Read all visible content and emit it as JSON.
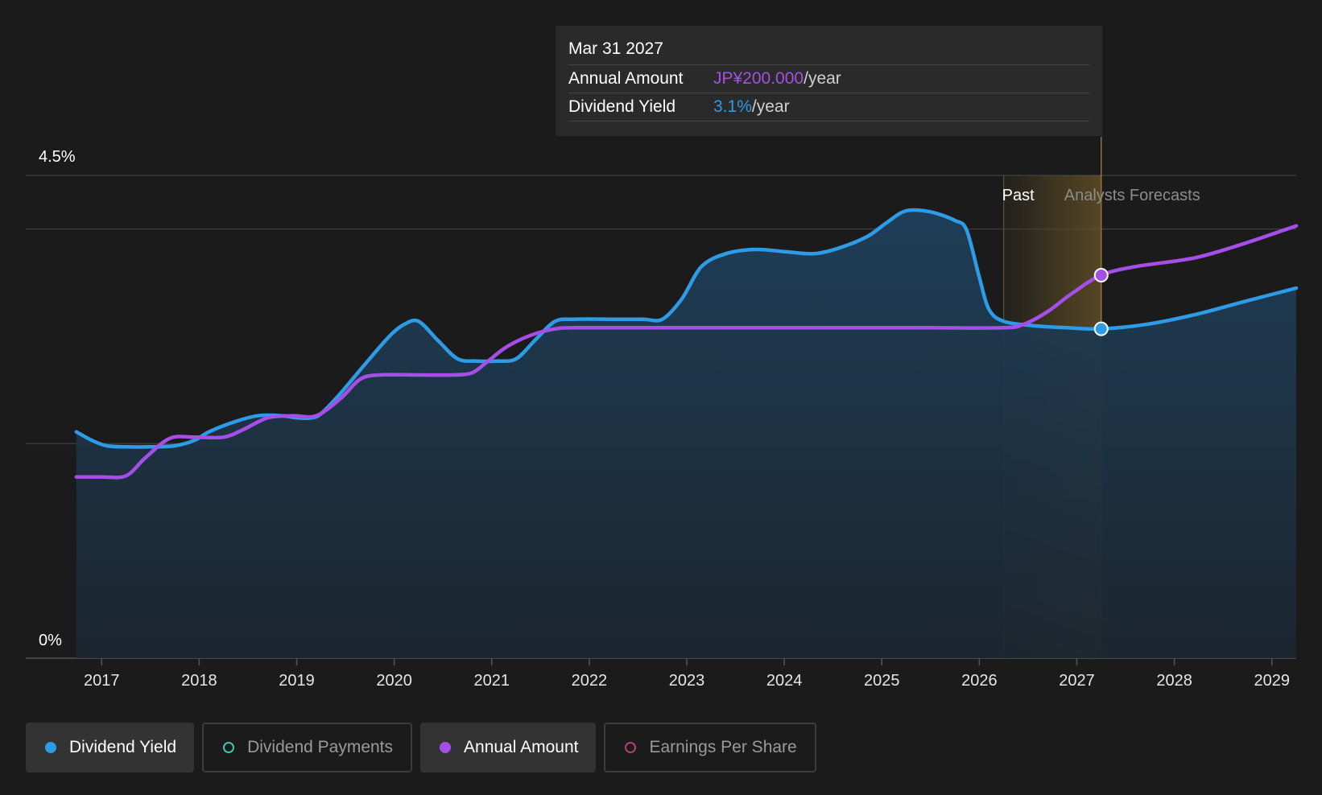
{
  "chart_data": {
    "type": "line",
    "y_ticks": [
      "4.5%",
      "0%"
    ],
    "ylim": [
      0,
      4.5
    ],
    "x_ticks": [
      "2017",
      "2018",
      "2019",
      "2020",
      "2021",
      "2022",
      "2023",
      "2024",
      "2025",
      "2026",
      "2027",
      "2028",
      "2029"
    ],
    "xlim": [
      2016.75,
      2029.25
    ],
    "zones": {
      "past_label": "Past",
      "forecast_label": "Analysts Forecasts",
      "past_end": 2026.25,
      "cursor": 2027.25
    },
    "series": [
      {
        "name": "Dividend Yield",
        "color": "#2d9be5",
        "fill": true,
        "points": [
          [
            2016.74,
            2.11
          ],
          [
            2016.9,
            2.03
          ],
          [
            2017.05,
            1.98
          ],
          [
            2017.25,
            1.97
          ],
          [
            2017.5,
            1.97
          ],
          [
            2017.75,
            1.98
          ],
          [
            2017.95,
            2.03
          ],
          [
            2018.1,
            2.11
          ],
          [
            2018.35,
            2.2
          ],
          [
            2018.6,
            2.26
          ],
          [
            2018.85,
            2.26
          ],
          [
            2019.0,
            2.24
          ],
          [
            2019.15,
            2.24
          ],
          [
            2019.25,
            2.28
          ],
          [
            2019.45,
            2.47
          ],
          [
            2019.7,
            2.74
          ],
          [
            2019.95,
            3.0
          ],
          [
            2020.1,
            3.11
          ],
          [
            2020.25,
            3.14
          ],
          [
            2020.45,
            2.96
          ],
          [
            2020.65,
            2.79
          ],
          [
            2020.85,
            2.77
          ],
          [
            2021.05,
            2.77
          ],
          [
            2021.25,
            2.79
          ],
          [
            2021.45,
            2.97
          ],
          [
            2021.65,
            3.14
          ],
          [
            2021.85,
            3.16
          ],
          [
            2022.25,
            3.16
          ],
          [
            2022.55,
            3.16
          ],
          [
            2022.75,
            3.16
          ],
          [
            2022.95,
            3.35
          ],
          [
            2023.15,
            3.65
          ],
          [
            2023.4,
            3.77
          ],
          [
            2023.7,
            3.81
          ],
          [
            2024.0,
            3.79
          ],
          [
            2024.3,
            3.77
          ],
          [
            2024.55,
            3.82
          ],
          [
            2024.85,
            3.93
          ],
          [
            2025.05,
            4.06
          ],
          [
            2025.25,
            4.17
          ],
          [
            2025.5,
            4.16
          ],
          [
            2025.75,
            4.08
          ],
          [
            2025.87,
            3.99
          ],
          [
            2026.0,
            3.55
          ],
          [
            2026.1,
            3.25
          ],
          [
            2026.25,
            3.14
          ],
          [
            2026.55,
            3.1
          ],
          [
            2026.9,
            3.08
          ],
          [
            2027.25,
            3.07
          ],
          [
            2027.7,
            3.11
          ],
          [
            2028.2,
            3.2
          ],
          [
            2028.7,
            3.32
          ],
          [
            2029.25,
            3.45
          ]
        ]
      },
      {
        "name": "Annual Amount",
        "color": "#a54ee8",
        "fill": false,
        "points": [
          [
            2016.74,
            1.69
          ],
          [
            2017.0,
            1.69
          ],
          [
            2017.25,
            1.7
          ],
          [
            2017.45,
            1.87
          ],
          [
            2017.7,
            2.05
          ],
          [
            2017.95,
            2.06
          ],
          [
            2018.25,
            2.06
          ],
          [
            2018.45,
            2.13
          ],
          [
            2018.7,
            2.24
          ],
          [
            2018.95,
            2.26
          ],
          [
            2019.2,
            2.26
          ],
          [
            2019.45,
            2.42
          ],
          [
            2019.65,
            2.6
          ],
          [
            2019.85,
            2.64
          ],
          [
            2020.25,
            2.64
          ],
          [
            2020.6,
            2.64
          ],
          [
            2020.8,
            2.66
          ],
          [
            2020.95,
            2.76
          ],
          [
            2021.15,
            2.9
          ],
          [
            2021.4,
            3.01
          ],
          [
            2021.65,
            3.07
          ],
          [
            2021.85,
            3.08
          ],
          [
            2022.5,
            3.08
          ],
          [
            2023.5,
            3.08
          ],
          [
            2024.5,
            3.08
          ],
          [
            2025.5,
            3.08
          ],
          [
            2026.25,
            3.08
          ],
          [
            2026.45,
            3.11
          ],
          [
            2026.7,
            3.23
          ],
          [
            2026.95,
            3.4
          ],
          [
            2027.25,
            3.57
          ],
          [
            2027.6,
            3.65
          ],
          [
            2028.2,
            3.73
          ],
          [
            2028.7,
            3.86
          ],
          [
            2029.25,
            4.03
          ]
        ]
      }
    ]
  },
  "tooltip": {
    "date": "Mar 31 2027",
    "rows": [
      {
        "label": "Annual Amount",
        "value": "JP¥200.000",
        "unit": "/year",
        "color": "#a54ee8"
      },
      {
        "label": "Dividend Yield",
        "value": "3.1%",
        "unit": "/year",
        "color": "#2d9be5"
      }
    ]
  },
  "legend": [
    {
      "label": "Dividend Yield",
      "color": "#2d9be5",
      "active": true
    },
    {
      "label": "Dividend Payments",
      "color": "#43c4b0",
      "active": false
    },
    {
      "label": "Annual Amount",
      "color": "#a54ee8",
      "active": true
    },
    {
      "label": "Earnings Per Share",
      "color": "#b0417a",
      "active": false
    }
  ]
}
